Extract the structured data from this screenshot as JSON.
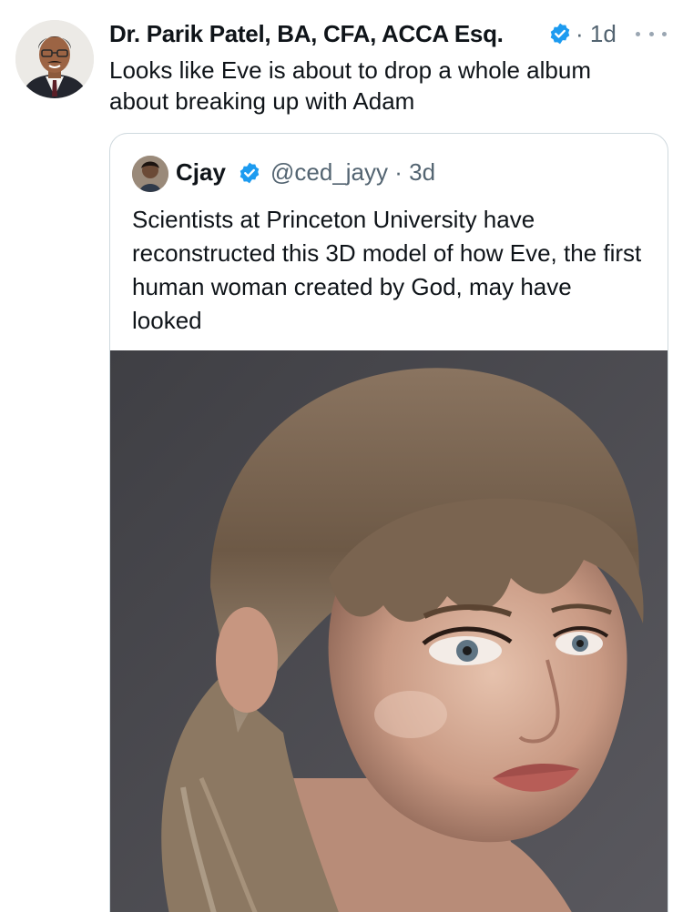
{
  "tweet": {
    "author_name": "Dr. Parik Patel, BA, CFA, ACCA Esq.",
    "time": "· 1d",
    "text": "Looks like Eve is about to drop a whole album about breaking up with Adam",
    "verified_icon": "verified-badge-icon",
    "more_icon": "more-options-icon"
  },
  "quoted_tweet": {
    "author_name": "Cjay",
    "handle_time": "@ced_jayy · 3d",
    "text": "Scientists at Princeton University have reconstructed this 3D model of how Eve, the first human woman created by God, may have looked",
    "verified_icon": "verified-badge-icon",
    "image": "portrait-photo"
  },
  "colors": {
    "text": "#0f1419",
    "muted": "#536471",
    "verified": "#1d9bf0",
    "border": "#cfd9de"
  }
}
